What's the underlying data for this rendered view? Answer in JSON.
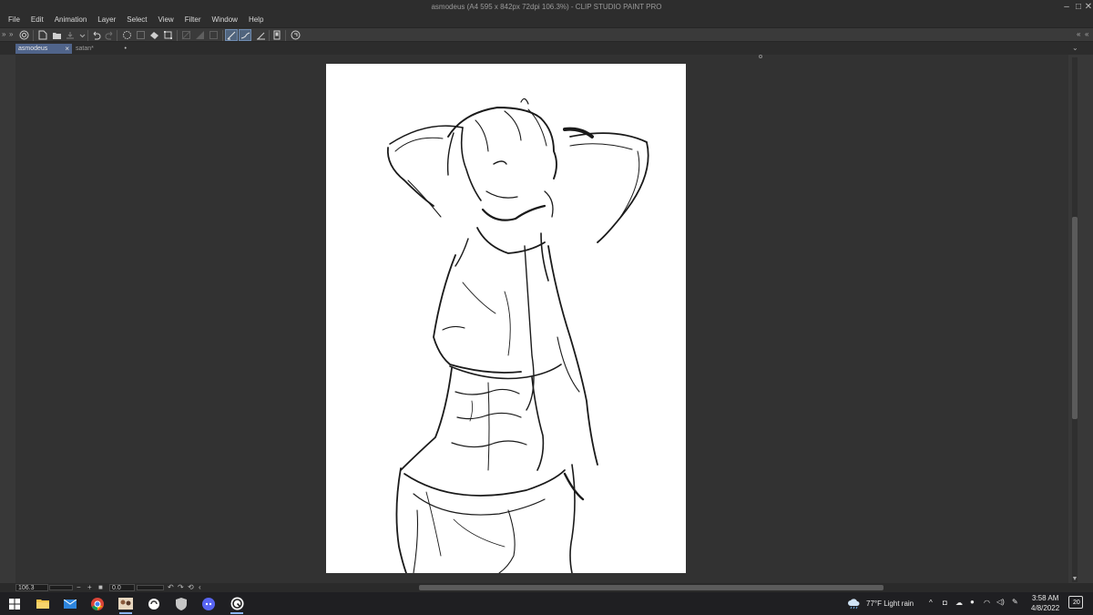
{
  "window": {
    "title": "asmodeus (A4 595 x 842px 72dpi 106.3%)  - CLIP STUDIO PAINT PRO",
    "controls": [
      "minimize-icon",
      "maximize-icon",
      "close-icon"
    ]
  },
  "menu": {
    "items": [
      "File",
      "Edit",
      "Animation",
      "Layer",
      "Select",
      "View",
      "Filter",
      "Window",
      "Help"
    ]
  },
  "toolbar": {
    "expand_left": "»",
    "expand_right": "»",
    "buttons": [
      {
        "name": "clip-studio-icon"
      },
      {
        "name": "new-file-icon"
      },
      {
        "name": "open-file-icon"
      },
      {
        "name": "save-icon"
      },
      {
        "name": "undo-icon"
      },
      {
        "name": "redo-icon"
      },
      {
        "name": "clear-icon"
      },
      {
        "name": "clear-outside-icon"
      },
      {
        "name": "fill-icon"
      },
      {
        "name": "transform-icon"
      },
      {
        "name": "hide-selection-icon"
      },
      {
        "name": "snap-ruler-icon",
        "active": true
      },
      {
        "name": "snap-special-ruler-icon",
        "active": true
      },
      {
        "name": "snap-grid-icon"
      },
      {
        "name": "device-icon"
      },
      {
        "name": "smartphone-icon"
      }
    ]
  },
  "tabs": [
    {
      "label": "asmodeus",
      "active": true,
      "close": "×"
    },
    {
      "label": "satan*",
      "active": false,
      "close": "•"
    }
  ],
  "status": {
    "zoom": "106.3",
    "zoom_minus": "−",
    "zoom_plus": "+",
    "angle": "0.0"
  },
  "taskbar": {
    "apps": [
      "start-icon",
      "file-explorer-icon",
      "mail-icon",
      "chrome-icon",
      "photos-icon",
      "clip-studio-icon",
      "discord-icon",
      "discord-icon",
      "clip-studio-paint-icon"
    ],
    "weather": "77°F  Light rain",
    "time": "3:58 AM",
    "date": "4/8/2022",
    "notifications": "20"
  },
  "colors": {
    "accent": "#50648a",
    "background": "#323232",
    "paper": "#ffffff"
  }
}
